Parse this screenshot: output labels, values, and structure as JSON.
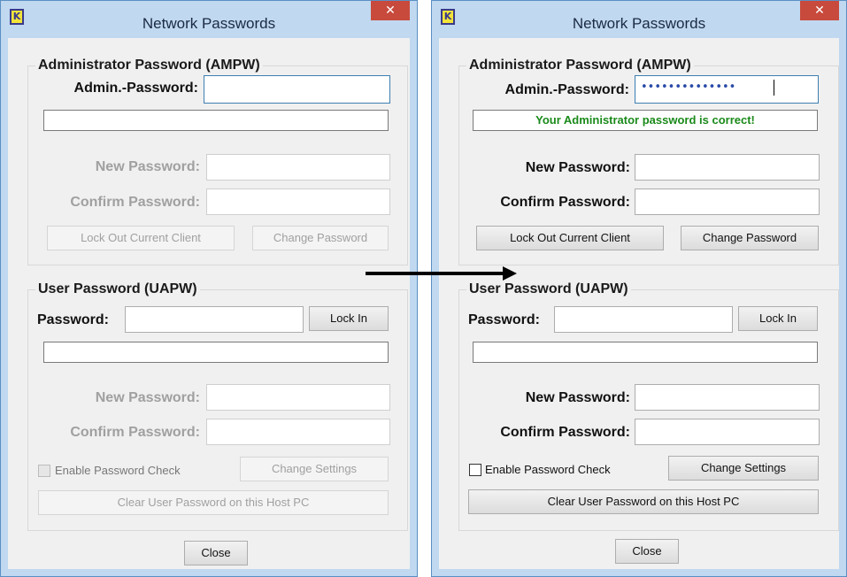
{
  "windows": {
    "before": {
      "title": "Network Passwords",
      "close_glyph": "✕",
      "admin": {
        "legend": "Administrator Password (AMPW)",
        "admin_label": "Admin.-Password:",
        "admin_value": "",
        "status": "",
        "new_label": "New Password:",
        "confirm_label": "Confirm Password:",
        "lockout_button": "Lock Out Current Client",
        "change_button": "Change Password"
      },
      "user": {
        "legend": "User Password (UAPW)",
        "password_label": "Password:",
        "lockin_button": "Lock In",
        "new_label": "New Password:",
        "confirm_label": "Confirm Password:",
        "enable_check_label": "Enable Password Check",
        "change_settings_button": "Change Settings",
        "clear_button": "Clear User Password on this Host PC"
      },
      "close_button": "Close"
    },
    "after": {
      "title": "Network Passwords",
      "close_glyph": "✕",
      "admin": {
        "legend": "Administrator Password (AMPW)",
        "admin_label": "Admin.-Password:",
        "admin_value": "••••••••••••••",
        "status": "Your Administrator password is correct!",
        "new_label": "New Password:",
        "confirm_label": "Confirm Password:",
        "lockout_button": "Lock Out Current Client",
        "change_button": "Change Password"
      },
      "user": {
        "legend": "User Password (UAPW)",
        "password_label": "Password:",
        "lockin_button": "Lock In",
        "new_label": "New Password:",
        "confirm_label": "Confirm Password:",
        "enable_check_label": "Enable Password Check",
        "change_settings_button": "Change Settings",
        "clear_button": "Clear User Password on this Host PC"
      },
      "close_button": "Close"
    }
  },
  "colors": {
    "title_bar": "#c0d8f0",
    "close_button": "#c84a3c",
    "status_ok": "#1a8a1a",
    "password_dots": "#2a4aa8"
  },
  "icons": {
    "app_icon": "app-logo-icon",
    "transition": "arrow-right-icon"
  }
}
